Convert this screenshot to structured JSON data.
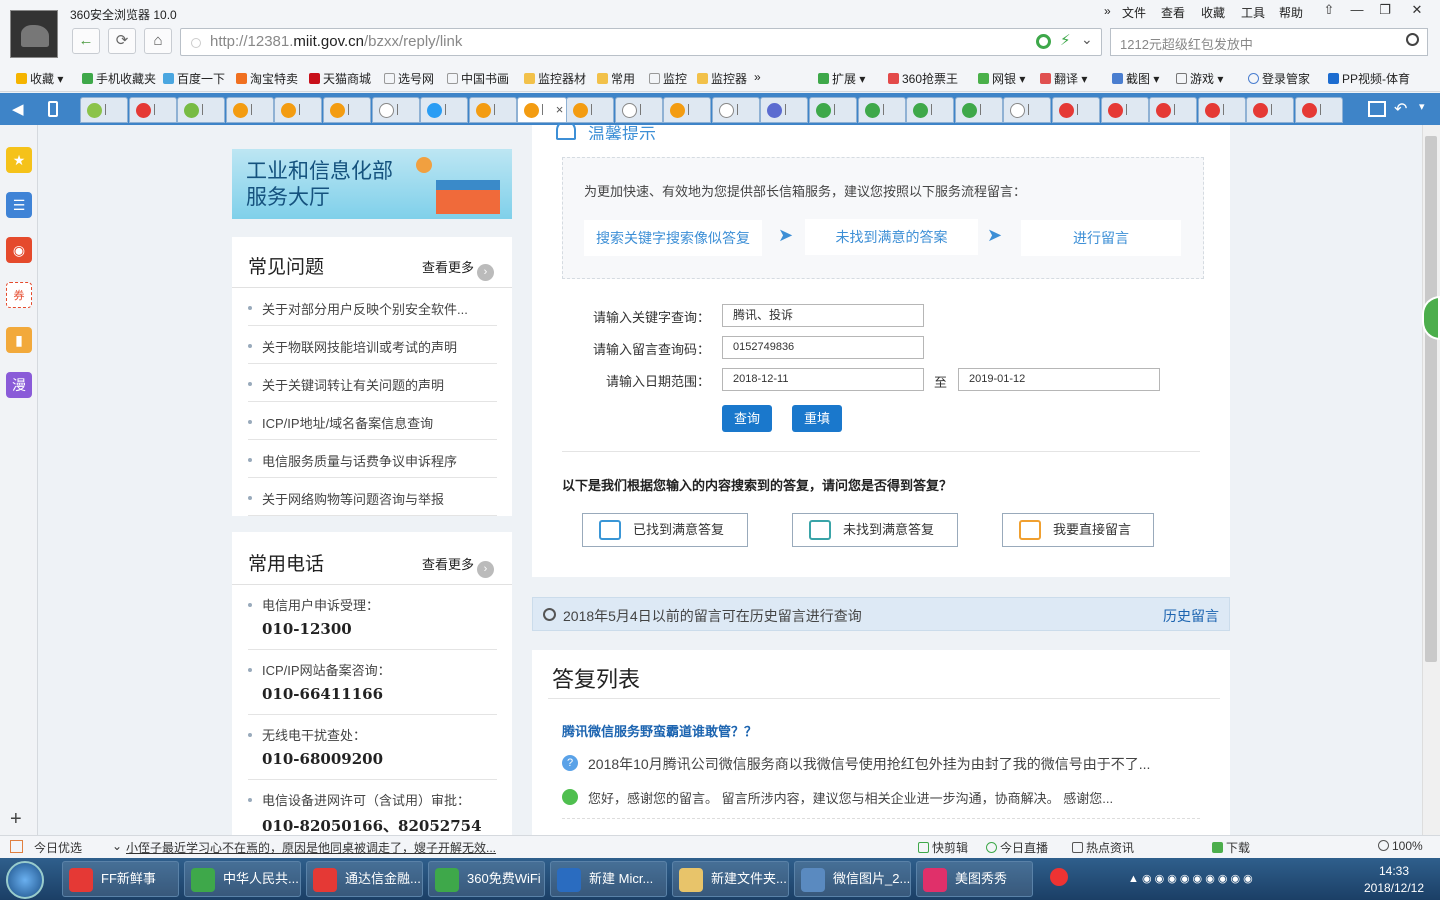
{
  "window": {
    "title": "360安全浏览器 10.0",
    "menu": [
      "文件",
      "查看",
      "收藏",
      "工具",
      "帮助"
    ],
    "controls": [
      "⇧",
      "—",
      "❐",
      "✕"
    ]
  },
  "nav": {
    "url_host_pre": "http://12381.",
    "url_host_main": "miit.gov.cn",
    "url_path": "/bzxx/reply/link",
    "search_placeholder": "1212元超级红包发放中"
  },
  "bookmarks": [
    "收藏",
    "手机收藏夹",
    "百度一下",
    "淘宝特卖",
    "天猫商城",
    "选号网",
    "中国书画",
    "监控器材",
    "常用",
    "监控",
    "监控器",
    "»"
  ],
  "bookmarks_right": [
    "扩展",
    "360抢票王",
    "网银",
    "翻译",
    "截图",
    "游戏",
    "登录管家",
    "PP视频-体育"
  ],
  "sidebar": {
    "banner_title": "工业和信息化部服务大厅",
    "faq_title": "常见问题",
    "faq_more": "查看更多",
    "faq_items": [
      "关于对部分用户反映个别安全软件...",
      "关于物联网技能培训或考试的声明",
      "关于关键词转让有关问题的声明",
      "ICP/IP地址/域名备案信息查询",
      "电信服务质量与话费争议申诉程序",
      "关于网络购物等问题咨询与举报"
    ],
    "phone_title": "常用电话",
    "phone_more": "查看更多",
    "phones": [
      {
        "label": "电信用户申诉受理：",
        "number": "010-12300"
      },
      {
        "label": "ICP/IP网站备案咨询：",
        "number": "010-66411166"
      },
      {
        "label": "无线电干扰查处：",
        "number": "010-68009200"
      },
      {
        "label": "电信设备进网许可（含试用）审批：",
        "number": "010-82050166、82052754"
      }
    ]
  },
  "main": {
    "tip_heading": "温馨提示",
    "tip_text": "为更加快速、有效地为您提供部长信箱服务，建议您按照以下服务流程留言：",
    "steps": [
      "搜索关键字搜索像似答复",
      "未找到满意的答案",
      "进行留言"
    ],
    "form": {
      "keyword_label": "请输入关键字查询：",
      "keyword_value": "腾讯、投诉",
      "code_label": "请输入留言查询码：",
      "code_value": "0152749836",
      "date_label": "请输入日期范围：",
      "date_from": "2018-12-11",
      "date_sep": "至",
      "date_to": "2019-01-12",
      "search_btn": "查询",
      "reset_btn": "重填"
    },
    "result_question": "以下是我们根据您输入的内容搜索到的答复，请问您是否得到答复？",
    "feedback": [
      "已找到满意答复",
      "未找到满意答复",
      "我要直接留言"
    ],
    "history_text": "2018年5月4日以前的留言可在历史留言进行查询",
    "history_link": "历史留言",
    "list_title": "答复列表",
    "item": {
      "title": "腾讯微信服务野蛮霸道谁敢管？？",
      "question": "2018年10月腾讯公司微信服务商以我微信号使用抢红包外挂为由封了我的微信号由于不了...",
      "answer": "您好，感谢您的留言。 留言所涉内容，建议您与相关企业进一步沟通，协商解决。 感谢您..."
    }
  },
  "status": {
    "left": "今日优选",
    "news": "小侄子最近学习心不在焉的，原因是他同桌被调走了，嫂子开解无效...",
    "right": [
      "快剪辑",
      "今日直播",
      "热点资讯",
      "下载",
      "100%"
    ]
  },
  "taskbar": {
    "tasks": [
      "FF新鲜事",
      "中华人民共...",
      "通达信金融...",
      "360免费WiFi",
      "新建 Micr...",
      "新建文件夹...",
      "微信图片_2...",
      "美图秀秀"
    ],
    "time": "14:33",
    "date": "2018/12/12"
  },
  "colors": {
    "accent": "#1a78cc",
    "link": "#3d8fd6",
    "title_blue": "#1c64b0"
  }
}
